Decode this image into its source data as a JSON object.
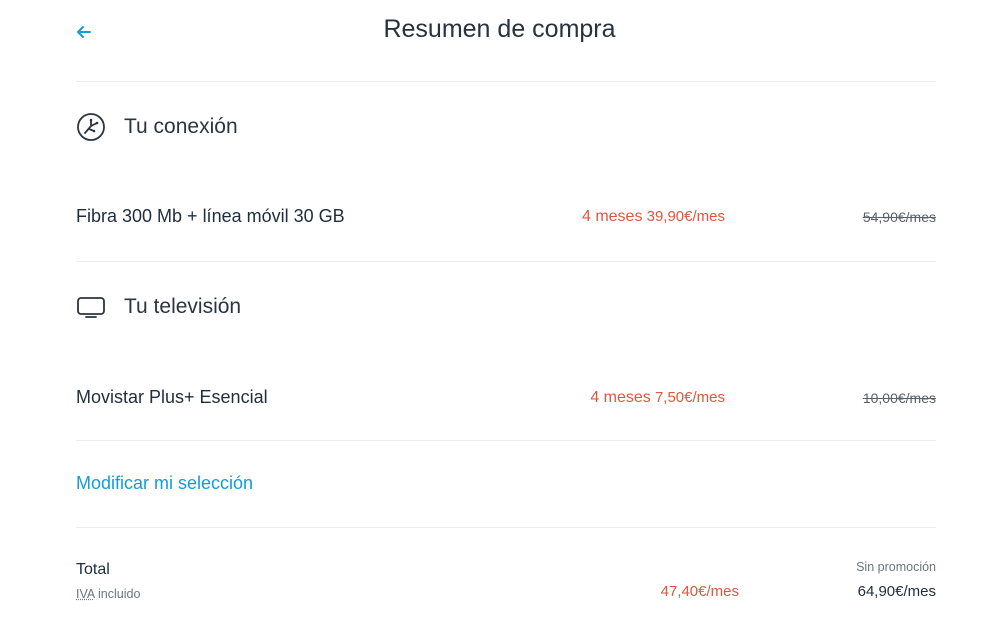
{
  "header": {
    "title": "Resumen de compra"
  },
  "sections": {
    "connection": {
      "title": "Tu conexión",
      "item_name": "Fibra 300 Mb + línea móvil 30 GB",
      "promo_months": "4 meses",
      "promo_price": "39,90€/mes",
      "old_price": "54,90€/mes"
    },
    "tv": {
      "title": "Tu televisión",
      "item_name": "Movistar Plus+ Esencial",
      "promo_months": "4 meses",
      "promo_price": "7,50€/mes",
      "old_price": "10,00€/mes"
    }
  },
  "modify_link": "Modificar mi selección",
  "total": {
    "label": "Total",
    "iva_abbr": "IVA",
    "iva_text": "incluido",
    "promo_value": "47,40€/mes",
    "no_promo_label": "Sin promoción",
    "no_promo_value": "64,90€/mes"
  },
  "colors": {
    "accent": "#149cd9",
    "promo": "#e0563f",
    "text": "#1f2d3d",
    "divider": "#eceef1"
  },
  "icons": {
    "back": "arrow-left-icon",
    "connection": "router-icon",
    "tv": "tv-icon"
  }
}
